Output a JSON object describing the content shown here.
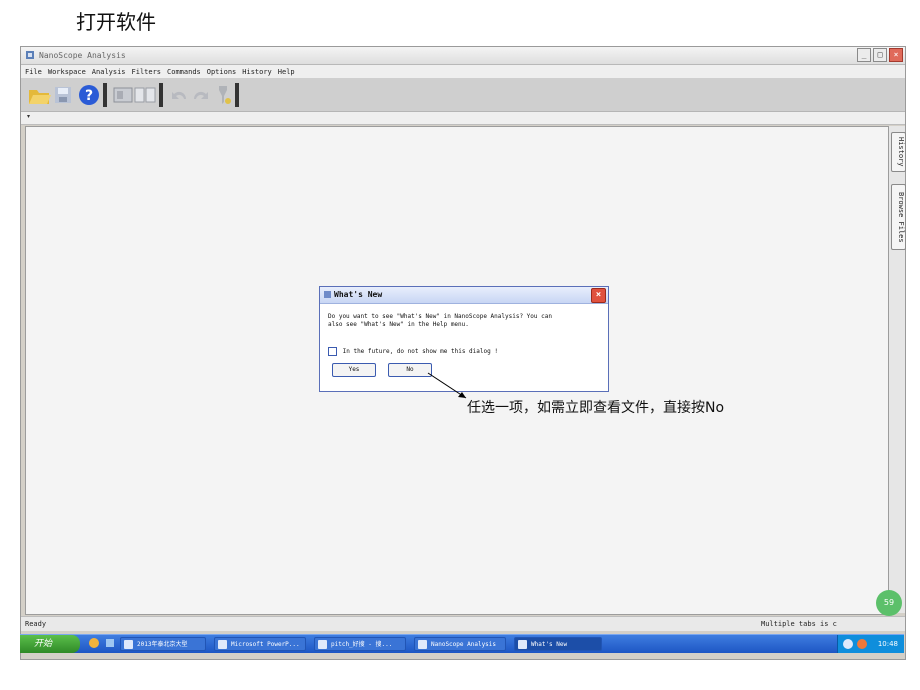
{
  "slide": {
    "title": "打开软件"
  },
  "window": {
    "title": "NanoScope Analysis",
    "controls": [
      "_",
      "□",
      "×"
    ]
  },
  "menu": [
    "File",
    "Workspace",
    "Analysis",
    "Filters",
    "Commands",
    "Options",
    "History",
    "Help"
  ],
  "toolbar_icons": [
    "open-folder-icon",
    "save-icon",
    "help-icon",
    "import-icon",
    "book-icon",
    "undo-icon",
    "redo-icon",
    "filter-icon"
  ],
  "tab_strip": {
    "arrow": "▾"
  },
  "side_tabs": {
    "history": "History",
    "browse": "Browse Files"
  },
  "dialog": {
    "title": "What's New",
    "body": "Do you want to see \"What's New\" in NanoScope Analysis? You can also see \"What's New\" in the Help menu.",
    "checkbox_label": "In the future, do not show me this dialog !",
    "yes_label": "Yes",
    "no_label": "No",
    "close": "×"
  },
  "annotation": "任选一项，如需立即查看文件，直接按No",
  "status": {
    "left": "Ready",
    "right": "Multiple tabs is c"
  },
  "green_badge": "59",
  "taskbar": {
    "start": "开始",
    "items": [
      "2013年泰北京大型",
      "Microsoft PowerP...",
      "pitch_好搜 - 搜...",
      "NanoScope Analysis",
      "What's New"
    ],
    "clock": "10:48"
  },
  "colors": {
    "taskbar": "#1d56c4",
    "start": "#3fa033",
    "dialog_border": "#5a6fb8",
    "close_red": "#e0513f"
  }
}
